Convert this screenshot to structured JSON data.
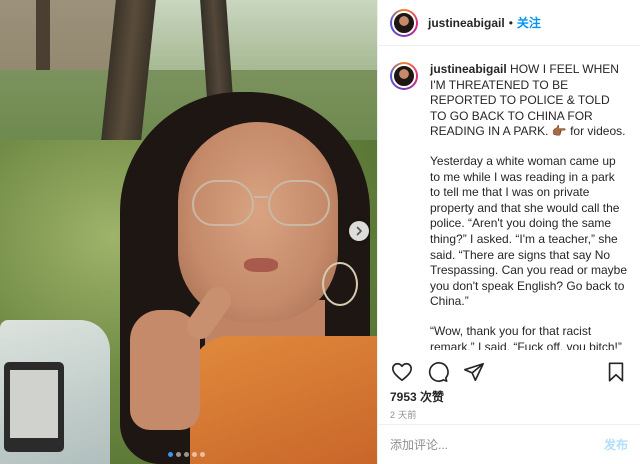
{
  "header": {
    "username": "justineabigail",
    "separator": "•",
    "follow_label": "关注"
  },
  "caption": {
    "username": "justineabigail",
    "paragraphs": [
      "HOW I FEEL WHEN I'M THREATENED TO BE REPORTED TO POLICE & TOLD TO GO BACK TO CHINA FOR READING IN A PARK. 👉🏾 for videos.",
      "Yesterday a white woman came up to me while I was reading in a park to tell me that I was on private property and that she would call the police. “Aren't you doing the same thing?” I asked. “I'm a teacher,” she said. “There are signs that say No Trespassing. Can you read or maybe you don't speak English? Go back to China.”",
      "“Wow, thank you for that racist remark,” I said. “Fuck off, you bitch!” she said. She said other things that are odd, but one was, she said “CALL"
    ]
  },
  "actions": {
    "like_icon": "heart-icon",
    "comment_icon": "comment-icon",
    "share_icon": "share-icon",
    "save_icon": "bookmark-icon"
  },
  "stats": {
    "likes": "7953 次赞",
    "time_ago": "2 天前"
  },
  "comment": {
    "placeholder": "添加评论...",
    "post_label": "发布"
  },
  "carousel": {
    "next_icon": "chevron-right-icon",
    "slide_count": 5,
    "active_index": 0
  },
  "colors": {
    "accent": "#0095f6",
    "post_disabled": "#b2dffc",
    "dot_active": "#3897f0"
  }
}
